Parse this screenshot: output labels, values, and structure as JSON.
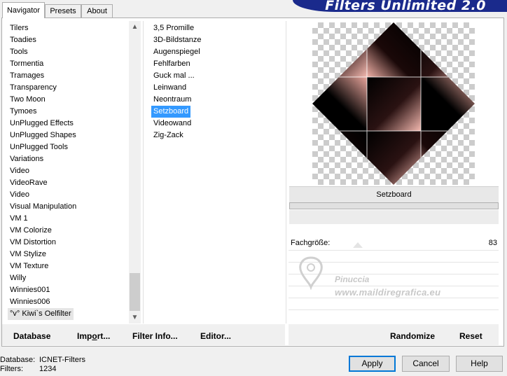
{
  "app": {
    "title": "Filters Unlimited 2.0"
  },
  "tabs": [
    {
      "label": "Navigator",
      "active": true
    },
    {
      "label": "Presets",
      "active": false
    },
    {
      "label": "About",
      "active": false
    }
  ],
  "categories": [
    "Tilers",
    "Toadies",
    "Tools",
    "Tormentia",
    "Tramages",
    "Transparency",
    "Two Moon",
    "Tymoes",
    "UnPlugged Effects",
    "UnPlugged Shapes",
    "UnPlugged Tools",
    "Variations",
    "Video",
    "VideoRave",
    "Video",
    "Visual Manipulation",
    "VM 1",
    "VM Colorize",
    "VM Distortion",
    "VM Stylize",
    "VM Texture",
    "Willy",
    "Winnies001",
    "Winnies006",
    "°v° Kiwi`s Oelfilter"
  ],
  "categories_highlighted": "°v° Kiwi`s Oelfilter",
  "filters": [
    "3,5 Promille",
    "3D-Bildstanze",
    "Augenspiegel",
    "Fehlfarben",
    "Guck mal ...",
    "Leinwand",
    "Neontraum",
    "Setzboard",
    "Videowand",
    "Zig-Zack"
  ],
  "selected_filter": "Setzboard",
  "preview": {
    "filter_name": "Setzboard"
  },
  "parameters": [
    {
      "label": "Fachgröße:",
      "value": "83"
    }
  ],
  "watermark": {
    "line1": "Pinuccia",
    "line2": "www.maildiregrafica.eu"
  },
  "bottom_left_buttons": [
    "Database",
    "Import...",
    "Filter Info...",
    "Editor..."
  ],
  "bottom_right_buttons": [
    "Randomize",
    "Reset"
  ],
  "status": {
    "database_label": "Database:",
    "database_value": "ICNET-Filters",
    "filters_label": "Filters:",
    "filters_value": "1234"
  },
  "dialog_buttons": {
    "apply": "Apply",
    "cancel": "Cancel",
    "help": "Help"
  },
  "colors": {
    "selection": "#3399ff",
    "banner": "#1a2a8c",
    "default_border": "#0078d7"
  }
}
